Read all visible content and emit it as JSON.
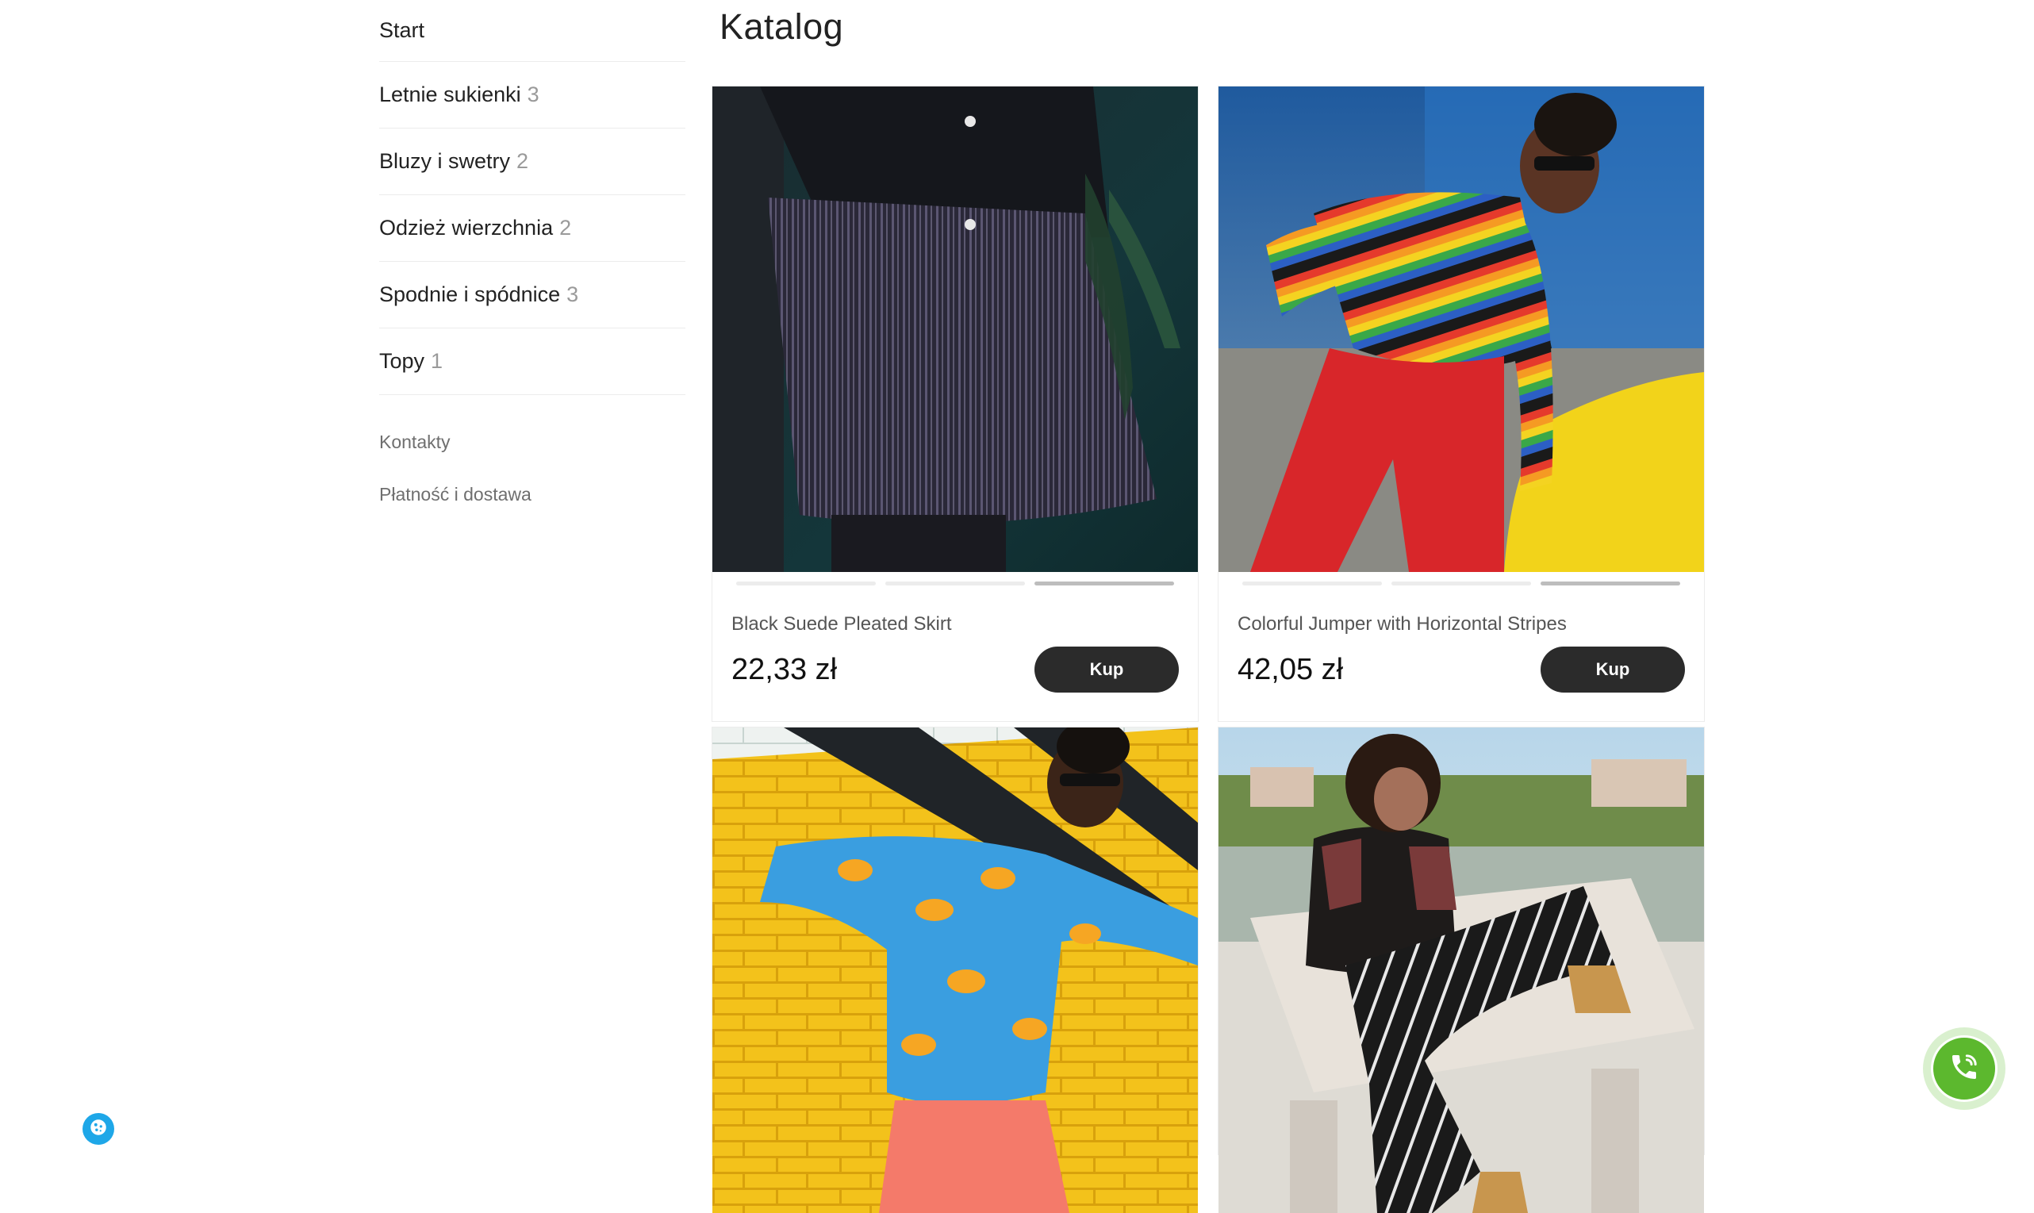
{
  "sidebar": {
    "categories": [
      {
        "label": "Start",
        "count": ""
      },
      {
        "label": "Letnie sukienki",
        "count": "3"
      },
      {
        "label": "Bluzy i swetry",
        "count": "2"
      },
      {
        "label": "Odzież wierzchnia",
        "count": "2"
      },
      {
        "label": "Spodnie i spódnice",
        "count": "3"
      },
      {
        "label": "Topy",
        "count": "1"
      }
    ],
    "links": [
      {
        "label": "Kontakty"
      },
      {
        "label": "Płatność i dostawa"
      }
    ]
  },
  "main": {
    "title": "Katalog",
    "products": [
      {
        "name": "Black Suede Pleated Skirt",
        "price": "22,33 zł",
        "buy_label": "Kup",
        "image_slides": 3,
        "active_slide": 3
      },
      {
        "name": "Colorful Jumper with Horizontal Stripes",
        "price": "42,05 zł",
        "buy_label": "Kup",
        "image_slides": 3,
        "active_slide": 3
      }
    ]
  },
  "colors": {
    "accent_dark": "#2b2b2b",
    "call_green": "#5cb82e",
    "cookie_blue": "#1ea7e8"
  },
  "icons": {
    "cookie": "cookie-icon",
    "call": "phone-icon"
  }
}
